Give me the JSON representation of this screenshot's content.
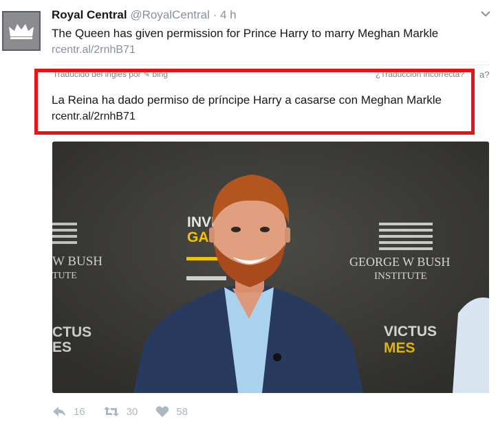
{
  "tweet": {
    "author_name": "Royal Central",
    "author_handle": "@RoyalCentral",
    "separator": "·",
    "time": "4 h",
    "text": "The Queen has given permission for Prince Harry to marry Meghan Markle",
    "link": "rcentr.al/2rnhB71"
  },
  "translation": {
    "attribution": "Traducido del inglés por",
    "provider": "bing",
    "wrong_translation": "¿Traducción incorrecta?",
    "text": "La Reina ha dado permiso de príncipe Harry a casarse con Meghan Markle",
    "link": "rcentr.al/2rnhB71"
  },
  "photo": {
    "backdrop_left": [
      "W BUSH",
      "TUTE",
      "CTUS",
      "ES"
    ],
    "backdrop_center": [
      "INVICTUS",
      "GAMES"
    ],
    "backdrop_right": [
      "GEORGE W BUSH",
      "INSTITUTE",
      "VICTUS",
      "MES"
    ]
  },
  "actions": {
    "reply_count": "16",
    "retweet_count": "30",
    "like_count": "58"
  },
  "icons": {
    "avatar": "crown-icon",
    "menu": "chevron-down-icon",
    "reply": "reply-icon",
    "retweet": "retweet-icon",
    "like": "heart-icon"
  }
}
